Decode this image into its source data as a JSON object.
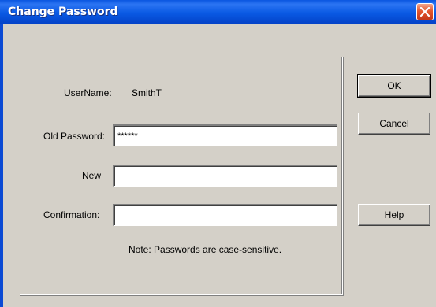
{
  "window": {
    "title": "Change Password"
  },
  "form": {
    "username_label": "UserName:",
    "username_value": "SmithT",
    "old_password_label": "Old Password:",
    "old_password_value": "******",
    "new_label": "New",
    "new_value": "",
    "confirmation_label": "Confirmation:",
    "confirmation_value": "",
    "note": "Note: Passwords are case-sensitive."
  },
  "buttons": {
    "ok": "OK",
    "cancel": "Cancel",
    "help": "Help"
  },
  "colors": {
    "titlebar": "#0a56e0",
    "close": "#e3572f",
    "face": "#d4d0c8"
  }
}
